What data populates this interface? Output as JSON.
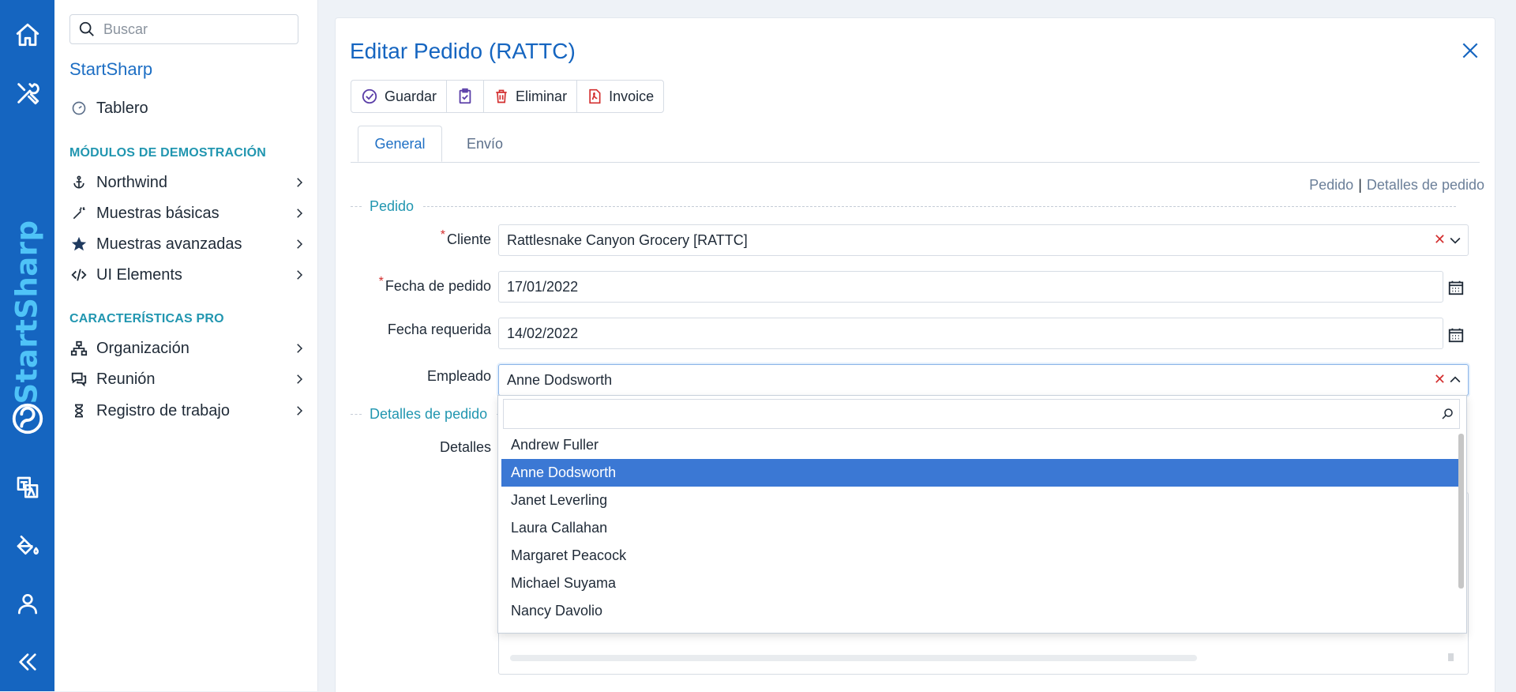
{
  "sidebar": {
    "search_placeholder": "Buscar",
    "app_name": "StartSharp",
    "dashboard": "Tablero",
    "section_demo": "MÓDULOS DE DEMOSTRACIÓN",
    "demo_items": [
      "Northwind",
      "Muestras básicas",
      "Muestras avanzadas",
      "UI Elements"
    ],
    "section_pro": "CARACTERÍSTICAS PRO",
    "pro_items": [
      "Organización",
      "Reunión",
      "Registro de trabajo"
    ]
  },
  "rail": {
    "brand_a": "Start",
    "brand_b": "Sharp"
  },
  "dialog": {
    "title": "Editar Pedido (RATTC)",
    "toolbar": {
      "save": "Guardar",
      "delete": "Eliminar",
      "invoice": "Invoice"
    },
    "tabs": [
      "General",
      "Envío"
    ],
    "links": [
      "Pedido",
      "Detalles de pedido"
    ],
    "cat_order": "Pedido",
    "cat_details": "Detalles de pedido",
    "labels": {
      "cliente": "Cliente",
      "fecha_pedido": "Fecha de pedido",
      "fecha_requerida": "Fecha requerida",
      "empleado": "Empleado",
      "detalles": "Detalles"
    },
    "values": {
      "cliente": "Rattlesnake Canyon Grocery [RATTC]",
      "fecha_pedido": "17/01/2022",
      "fecha_requerida": "14/02/2022",
      "empleado": "Anne Dodsworth"
    },
    "employees": [
      "Andrew Fuller",
      "Anne Dodsworth",
      "Janet Leverling",
      "Laura Callahan",
      "Margaret Peacock",
      "Michael Suyama",
      "Nancy Davolio"
    ],
    "selected_employee_index": 1
  },
  "colors": {
    "rail": "#1565c0",
    "accent": "#1e6fc4",
    "section": "#2196b0",
    "selected": "#3b78d4",
    "danger": "#d32f2f"
  }
}
